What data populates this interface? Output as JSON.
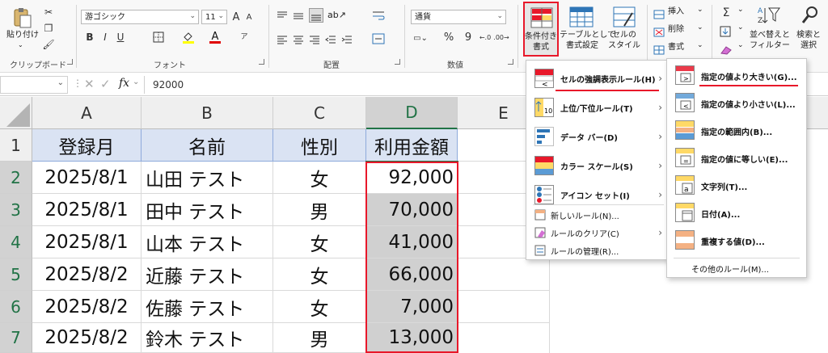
{
  "ribbon": {
    "clipboard": {
      "paste": "貼り付け",
      "group": "クリップボード"
    },
    "font": {
      "name": "游ゴシック",
      "size": "11",
      "bold": "B",
      "italic": "I",
      "underline": "U",
      "grow": "A",
      "shrink": "A",
      "group": "フォント"
    },
    "alignment": {
      "group": "配置"
    },
    "number": {
      "format": "通貨",
      "percent": "%",
      "comma": "9",
      "group": "数値"
    },
    "styles": {
      "cond_format_line1": "条件付き",
      "cond_format_line2": "書式",
      "table_line1": "テーブルとして",
      "table_line2": "書式設定",
      "cell_style_line1": "セルの",
      "cell_style_line2": "スタイル"
    },
    "cells": {
      "insert": "挿入",
      "delete": "削除",
      "format": "書式"
    },
    "editing": {
      "sigma": "Σ",
      "sort_line1": "並べ替えと",
      "sort_line2": "フィルター",
      "find_line1": "検索と",
      "find_line2": "選択"
    }
  },
  "formula_bar": {
    "fx": "fx",
    "value": "92000"
  },
  "columns": [
    "A",
    "B",
    "C",
    "D",
    "E"
  ],
  "rows": [
    {
      "num": "1",
      "a": "登録月",
      "b": "名前",
      "c": "性別",
      "d": "利用金額"
    },
    {
      "num": "2",
      "a": "2025/8/1",
      "b": "山田 テスト",
      "c": "女",
      "d": "92,000"
    },
    {
      "num": "3",
      "a": "2025/8/1",
      "b": "田中 テスト",
      "c": "男",
      "d": "70,000"
    },
    {
      "num": "4",
      "a": "2025/8/1",
      "b": "山本 テスト",
      "c": "女",
      "d": "41,000"
    },
    {
      "num": "5",
      "a": "2025/8/2",
      "b": "近藤 テスト",
      "c": "女",
      "d": "66,000"
    },
    {
      "num": "6",
      "a": "2025/8/2",
      "b": "佐藤 テスト",
      "c": "女",
      "d": "7,000"
    },
    {
      "num": "7",
      "a": "2025/8/2",
      "b": "鈴木 テスト",
      "c": "男",
      "d": "13,000"
    }
  ],
  "cond_menu": {
    "items": [
      {
        "label": "セルの強調表示ルール(H)"
      },
      {
        "label": "上位/下位ルール(T)"
      },
      {
        "label": "データ バー(D)"
      },
      {
        "label": "カラー スケール(S)"
      },
      {
        "label": "アイコン セット(I)"
      }
    ],
    "small": [
      {
        "label": "新しいルール(N)..."
      },
      {
        "label": "ルールのクリア(C)"
      },
      {
        "label": "ルールの管理(R)..."
      }
    ]
  },
  "sub_menu": {
    "items": [
      {
        "label": "指定の値より大きい(G)..."
      },
      {
        "label": "指定の値より小さい(L)..."
      },
      {
        "label": "指定の範囲内(B)..."
      },
      {
        "label": "指定の値に等しい(E)..."
      },
      {
        "label": "文字列(T)..."
      },
      {
        "label": "日付(A)..."
      },
      {
        "label": "重複する値(D)..."
      }
    ],
    "more": "その他のルール(M)..."
  },
  "colors": {
    "header_fill": "#dae3f3",
    "selected_fill": "#d0d0d0",
    "highlight_red": "#e8182a",
    "excel_green": "#217346"
  }
}
